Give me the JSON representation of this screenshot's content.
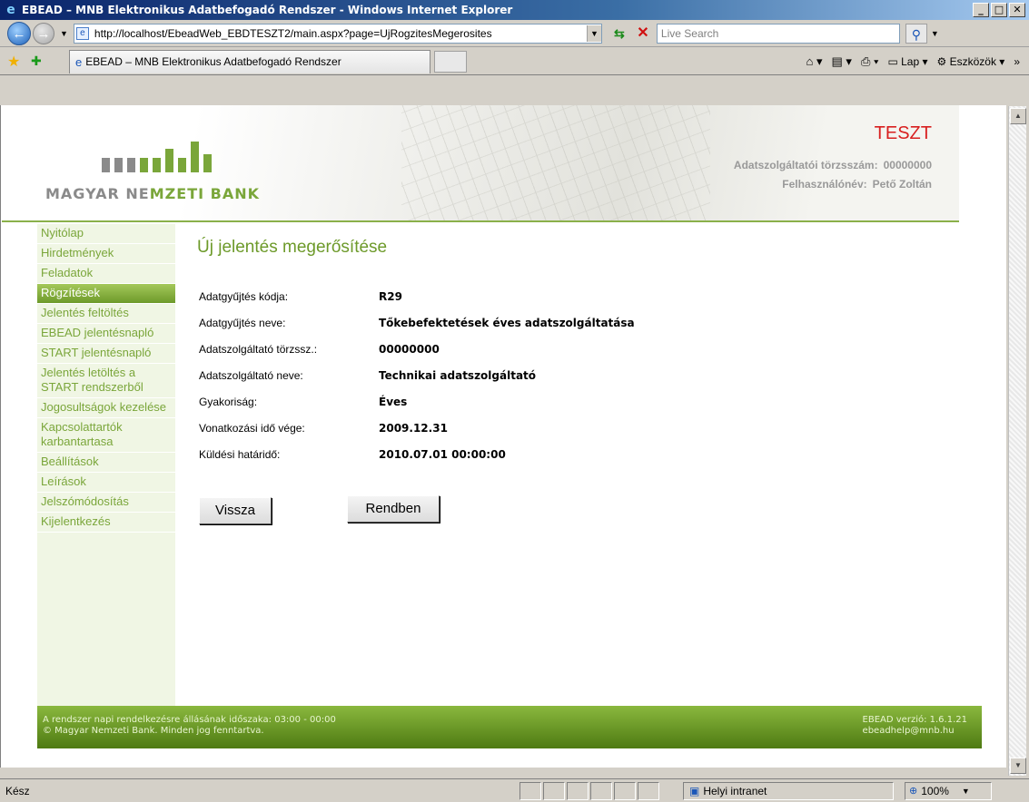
{
  "window": {
    "title": "EBEAD – MNB Elektronikus Adatbefogadó Rendszer - Windows Internet Explorer",
    "minimize": "_",
    "maximize": "□",
    "close": "✕"
  },
  "address": {
    "url": "http://localhost/EbeadWeb_EBDTESZT2/main.aspx?page=UjRogzitesMegerosites",
    "search_placeholder": "Live Search"
  },
  "tab": {
    "label": "EBEAD – MNB Elektronikus Adatbefogadó Rendszer"
  },
  "commands": {
    "page": "Lap",
    "tools": "Eszközök"
  },
  "banner": {
    "bank_name_part1": "MAGYAR NE",
    "bank_name_part2": "MZETI BANK",
    "env_label": "TESZT",
    "provider_id_label": "Adatszolgáltatói törzsszám:",
    "provider_id_value": "00000000",
    "username_label": "Felhasználónév:",
    "username_value": "Pető Zoltán"
  },
  "sidebar": {
    "items": [
      {
        "label": "Nyitólap"
      },
      {
        "label": "Hirdetmények"
      },
      {
        "label": "Feladatok"
      },
      {
        "label": "Rögzítések"
      },
      {
        "label": "Jelentés feltöltés"
      },
      {
        "label": "EBEAD jelentésnapló"
      },
      {
        "label": "START jelentésnapló"
      },
      {
        "label": "Jelentés letöltés a START rendszerből"
      },
      {
        "label": "Jogosultságok kezelése"
      },
      {
        "label": "Kapcsolattartók karbantartasa"
      },
      {
        "label": "Beállítások"
      },
      {
        "label": "Leírások"
      },
      {
        "label": "Jelszómódosítás"
      },
      {
        "label": "Kijelentkezés"
      }
    ],
    "active_index": 3
  },
  "main": {
    "title": "Új jelentés megerősítése",
    "fields": [
      {
        "label": "Adatgyűjtés kódja:",
        "value": "R29"
      },
      {
        "label": "Adatgyűjtés neve:",
        "value": "Tőkebefektetések éves adatszolgáltatása"
      },
      {
        "label": "Adatszolgáltató törzssz.:",
        "value": "00000000"
      },
      {
        "label": "Adatszolgáltató neve:",
        "value": "Technikai adatszolgáltató"
      },
      {
        "label": "Gyakoriság:",
        "value": "Éves"
      },
      {
        "label": "Vonatkozási idő vége:",
        "value": "2009.12.31"
      },
      {
        "label": "Küldési határidő:",
        "value": "2010.07.01 00:00:00"
      }
    ],
    "back_button": "Vissza",
    "ok_button": "Rendben"
  },
  "footer": {
    "availability": "A rendszer napi rendelkezésre állásának időszaka: 03:00 - 00:00",
    "copyright": "© Magyar Nemzeti Bank. Minden jog fenntartva.",
    "version": "EBEAD verzió: 1.6.1.21",
    "email": "ebeadhelp@mnb.hu"
  },
  "status": {
    "text": "Kész",
    "zone": "Helyi intranet",
    "zoom": "100%"
  },
  "colors": {
    "accent_green": "#7aa63a",
    "test_red": "#d81f1f"
  }
}
